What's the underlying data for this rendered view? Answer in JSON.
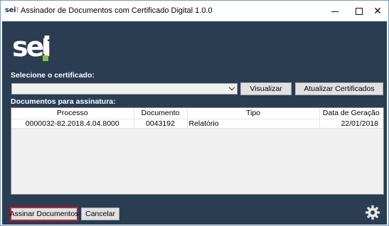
{
  "window": {
    "logo_text": "sei",
    "title": "Assinador de Documentos com Certificado Digital 1.0.0",
    "minimize_icon": "minimize-icon",
    "maximize_icon": "maximize-icon",
    "close_label": "✕"
  },
  "brand": {
    "logo_text": "sei",
    "accent_color": "#8cbf3f",
    "background_color": "#2a3d52"
  },
  "certificate": {
    "label": "Selecione o certificado:",
    "selected_value": "",
    "view_button": "Visualizar",
    "refresh_button": "Atualizar Certificados"
  },
  "documents": {
    "label": "Documentos para assinatura:",
    "columns": [
      "Processo",
      "Documento",
      "Tipo",
      "Data de Geração"
    ],
    "rows": [
      {
        "processo": "0000032-82.2018.4.04.8000",
        "documento": "0043192",
        "tipo": "Relatório",
        "data": "22/01/2018"
      }
    ]
  },
  "actions": {
    "sign_button": "Assinar Documentos",
    "cancel_button": "Cancelar",
    "highlight_color": "#c8202e",
    "settings_icon": "gear-icon"
  }
}
